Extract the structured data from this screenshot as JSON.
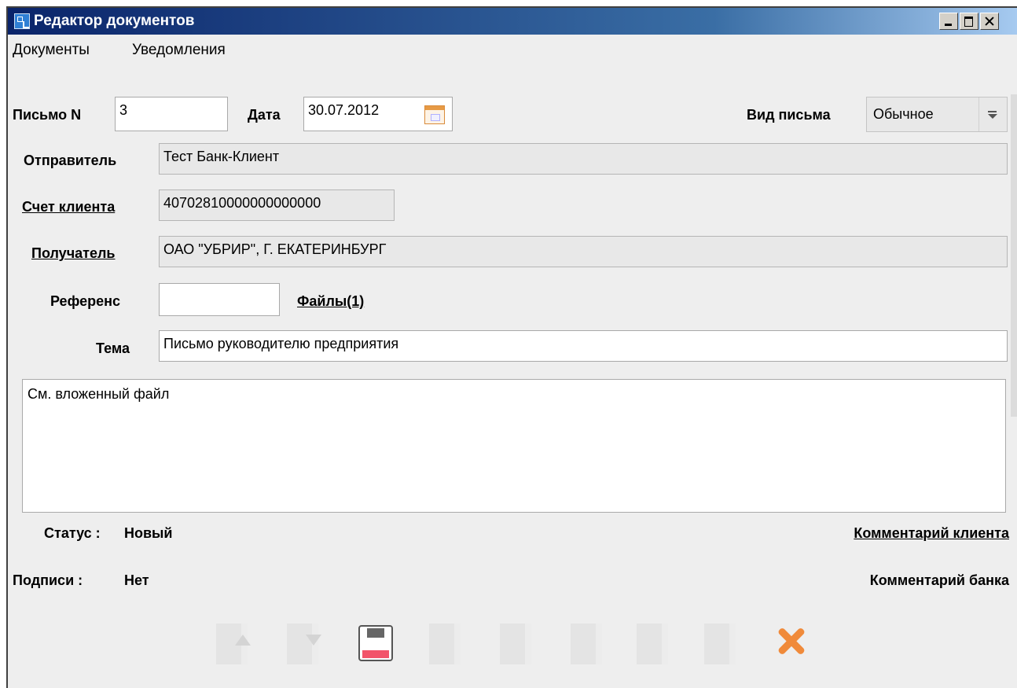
{
  "window": {
    "title": "Редактор документов"
  },
  "menu": {
    "items": [
      "Документы",
      "Уведомления"
    ]
  },
  "form": {
    "letter_no_label": "Письмо N",
    "letter_no_value": "3",
    "date_label": "Дата",
    "date_value": "30.07.2012",
    "kind_label": "Вид письма",
    "kind_value": "Обычное",
    "sender_label": "Отправитель",
    "sender_value": "Тест Банк-Клиент",
    "account_label": "Счет клиента",
    "account_value": "40702810000000000000",
    "recipient_label": "Получатель",
    "recipient_value": "ОАО \"УБРИР\", Г. ЕКАТЕРИНБУРГ",
    "reference_label": "Референс",
    "reference_value": "",
    "files_link": "Файлы(1)",
    "subject_label": "Тема",
    "subject_value": "Письмо руководителю предприятия",
    "body_text": "См. вложенный файл"
  },
  "status": {
    "status_label": "Статус :",
    "status_value": "Новый",
    "signatures_label": "Подписи :",
    "signatures_value": "Нет",
    "client_comment_link": "Комментарий клиента",
    "bank_comment_label": "Комментарий банка"
  },
  "toolbar": {
    "icons": [
      "import-icon",
      "export-icon",
      "save-icon",
      "template-icon",
      "sign-icon",
      "copy-icon",
      "print-icon",
      "delete-icon",
      "close-icon"
    ],
    "colors": {
      "save_stripe": "#f2546a",
      "close_x": "#f08a3a"
    }
  }
}
